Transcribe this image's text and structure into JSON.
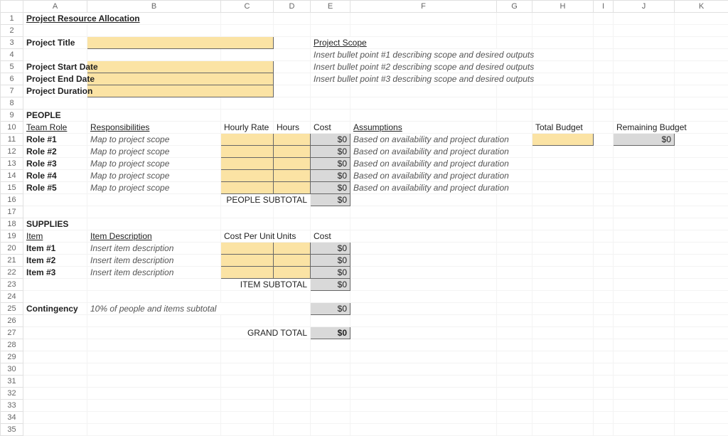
{
  "cols": [
    "A",
    "B",
    "C",
    "D",
    "E",
    "F",
    "G",
    "H",
    "I",
    "J",
    "K"
  ],
  "rowCount": 35,
  "A1": "Project Resource Allocation",
  "A3": "Project Title",
  "A5": "Project Start Date",
  "A6": "Project End Date",
  "A7": "Project Duration",
  "E3": "Project Scope",
  "E4": "Insert bullet point #1 describing scope and desired outputs",
  "E5": "Insert bullet point #2 describing scope and desired outputs",
  "E6": "Insert bullet point #3 describing scope and desired outputs",
  "A9": "PEOPLE",
  "A10": "Team Role",
  "B10": "Responsibilities",
  "C10": "Hourly Rate",
  "D10": "Hours",
  "E10": "Cost",
  "F10": "Assumptions",
  "H10": "Total Budget",
  "J10": "Remaining Budget",
  "A11": "Role #1",
  "B11": "Map to project scope",
  "E11": "$0",
  "F11": "Based on availability and project duration",
  "A12": "Role #2",
  "B12": "Map to project scope",
  "E12": "$0",
  "F12": "Based on availability and project duration",
  "A13": "Role #3",
  "B13": "Map to project scope",
  "E13": "$0",
  "F13": "Based on availability and project duration",
  "A14": "Role #4",
  "B14": "Map to project scope",
  "E14": "$0",
  "F14": "Based on availability and project duration",
  "A15": "Role #5",
  "B15": "Map to project scope",
  "E15": "$0",
  "F15": "Based on availability and project duration",
  "D16": "PEOPLE SUBTOTAL",
  "E16": "$0",
  "J11": "$0",
  "A18": "SUPPLIES",
  "A19": "Item",
  "B19": "Item Description",
  "C19": "Cost Per Unit",
  "D19": "Units",
  "E19": "Cost",
  "A20": "Item #1",
  "B20": "Insert item description",
  "E20": "$0",
  "A21": "Item #2",
  "B21": "Insert item description",
  "E21": "$0",
  "A22": "Item #3",
  "B22": "Insert item description",
  "E22": "$0",
  "D23": "ITEM SUBTOTAL",
  "E23": "$0",
  "A25": "Contingency",
  "B25": "10% of people and items subtotal",
  "E25": "$0",
  "D27": "GRAND TOTAL",
  "E27": "$0"
}
